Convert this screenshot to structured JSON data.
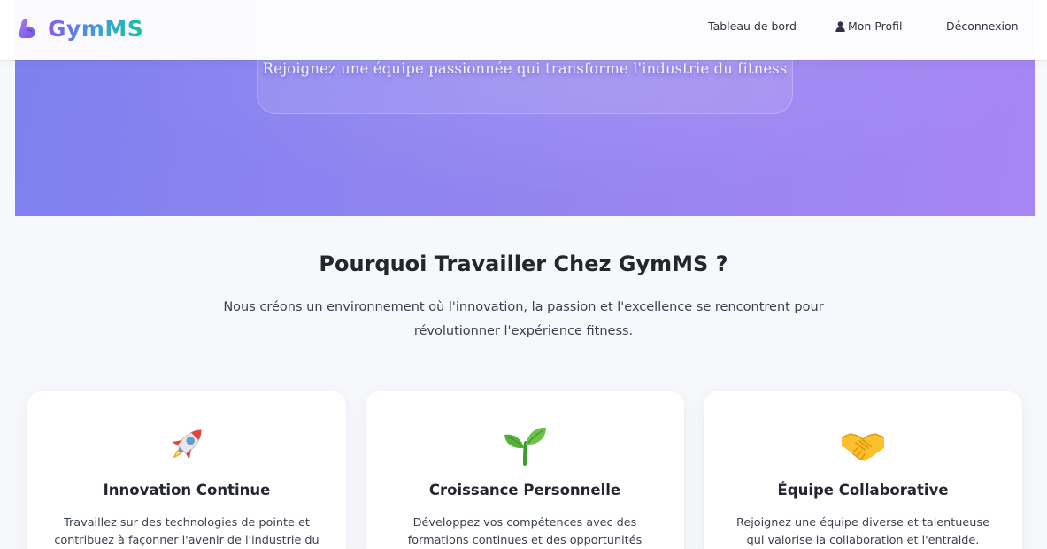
{
  "navbar": {
    "brand": "GymMS",
    "links": {
      "dashboard": "Tableau de bord",
      "profile": "Mon Profil",
      "logout": "Déconnexion"
    }
  },
  "hero": {
    "subtitle": "Rejoignez une équipe passionnée qui transforme l'industrie du fitness"
  },
  "why_section": {
    "title": "Pourquoi Travailler Chez GymMS ?",
    "text": "Nous créons un environnement où l'innovation, la passion et l'excellence se rencontrent pour révolutionner l'expérience fitness."
  },
  "cards": [
    {
      "icon": "rocket-icon",
      "title": "Innovation Continue",
      "text": "Travaillez sur des technologies de pointe et contribuez à façonner l'avenir de l'industrie du"
    },
    {
      "icon": "seedling-icon",
      "title": "Croissance Personnelle",
      "text": "Développez vos compétences avec des formations continues et des opportunités"
    },
    {
      "icon": "handshake-icon",
      "title": "Équipe Collaborative",
      "text": "Rejoignez une équipe diverse et talentueuse qui valorise la collaboration et l'entraide."
    }
  ],
  "colors": {
    "hero_gradient_start": "#7e80ef",
    "hero_gradient_end": "#a686f2",
    "brand_gradient": [
      "#8a5cf0",
      "#3aa0d6",
      "#16c0a6"
    ]
  }
}
